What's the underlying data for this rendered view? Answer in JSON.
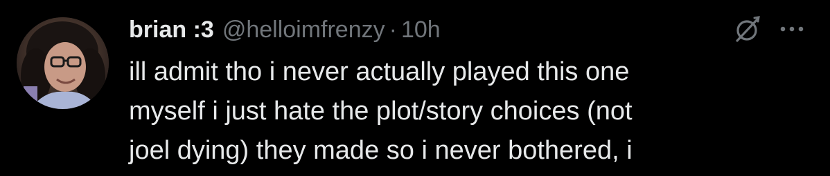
{
  "tweet": {
    "author": {
      "display_name": "brian :3",
      "handle": "@helloimfrenzy",
      "separator": "·",
      "timestamp": "10h"
    },
    "text_lines": [
      "ill admit tho i never actually played this one",
      "myself i just hate the plot/story choices (not",
      "joel dying) they made so i never bothered, i"
    ],
    "icons": {
      "grok": "grok-slash-circle-icon",
      "more": "more-options-icon"
    }
  },
  "colors": {
    "background": "#000000",
    "primary_text": "#e7e9ea",
    "secondary_text": "#71767b"
  }
}
